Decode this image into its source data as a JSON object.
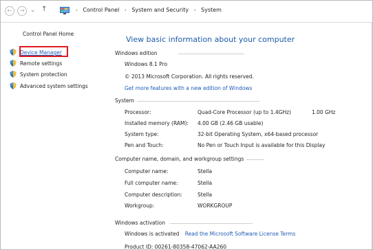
{
  "address": {
    "crumbs": [
      "Control Panel",
      "System and Security",
      "System"
    ]
  },
  "left": {
    "home": "Control Panel Home",
    "tasks": [
      {
        "label": "Device Manager",
        "highlighted": true
      },
      {
        "label": "Remote settings"
      },
      {
        "label": "System protection"
      },
      {
        "label": "Advanced system settings"
      }
    ]
  },
  "main": {
    "title": "View basic information about your computer",
    "edition": {
      "heading": "Windows edition",
      "name": "Windows 8.1 Pro",
      "copyright": "© 2013 Microsoft Corporation. All rights reserved.",
      "link": "Get more features with a new edition of Windows"
    },
    "system": {
      "heading": "System",
      "rows": [
        {
          "label": "Processor:",
          "value": "Quad-Core Processor (up to 1.4GHz)",
          "extra": "1.00 GHz"
        },
        {
          "label": "Installed memory (RAM):",
          "value": "4.00 GB (2.46 GB usable)"
        },
        {
          "label": "System type:",
          "value": "32-bit Operating System, x64-based processor"
        },
        {
          "label": "Pen and Touch:",
          "value": "No Pen or Touch Input is available for this Display"
        }
      ]
    },
    "computer_name": {
      "heading": "Computer name, domain, and workgroup settings",
      "rows": [
        {
          "label": "Computer name:",
          "value": "Stella"
        },
        {
          "label": "Full computer name:",
          "value": "Stella"
        },
        {
          "label": "Computer description:",
          "value": "Stella"
        },
        {
          "label": "Workgroup:",
          "value": "WORKGROUP"
        }
      ]
    },
    "activation": {
      "heading": "Windows activation",
      "status": "Windows is activated",
      "link": "Read the Microsoft Software License Terms",
      "product_id": "Product ID: 00261-80358-47062-AA260"
    }
  },
  "colors": {
    "link": "#1e5bb8",
    "highlight": "#e0171f",
    "title": "#1b5aa8"
  }
}
